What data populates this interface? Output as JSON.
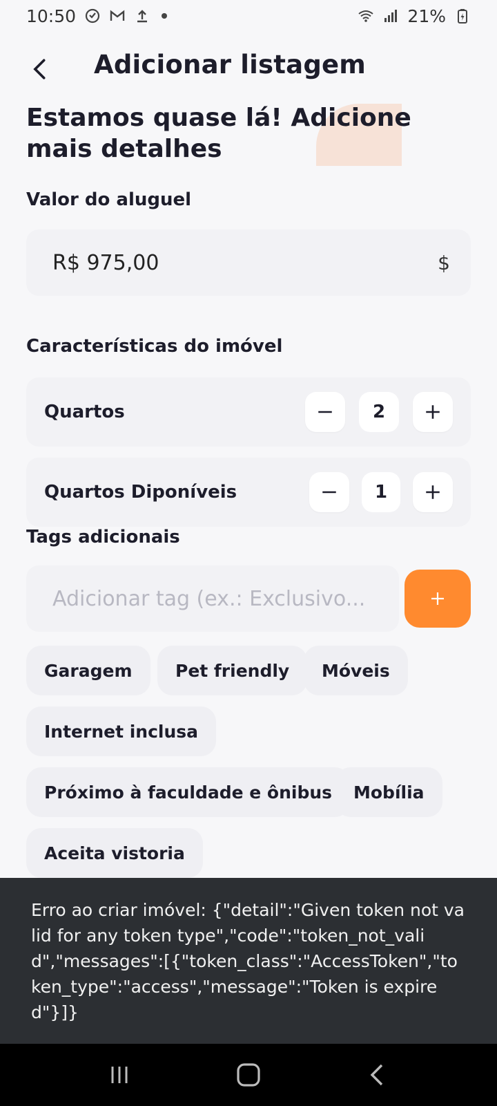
{
  "status_bar": {
    "time": "10:50",
    "battery": "21%",
    "icons_left": [
      "notification-icon",
      "gmail-icon",
      "upload-icon"
    ],
    "icons_right": [
      "wifi-icon",
      "signal-icon",
      "battery-charging-icon"
    ]
  },
  "header": {
    "title": "Adicionar listagem"
  },
  "headline": {
    "line1": "Estamos quase lá! Adicione",
    "line2": "mais detalhes",
    "accent_color": "#f7e2d7"
  },
  "rent": {
    "label": "Valor do aluguel",
    "value": "R$ 975,00",
    "suffix": "$"
  },
  "features": {
    "label": "Características do imóvel",
    "rows": [
      {
        "label": "Quartos",
        "value": "2"
      },
      {
        "label": "Quartos Diponíveis",
        "value": "1"
      }
    ]
  },
  "tags": {
    "label": "Tags adicionais",
    "placeholder": "Adicionar tag (ex.: Exclusivo...",
    "add_button_color": "#ff8a2f",
    "items": [
      "Garagem",
      "Pet friendly",
      "Móveis",
      "Internet inclusa",
      "Próximo à faculdade e ônibus",
      "Mobília",
      "Aceita vistoria"
    ]
  },
  "snackbar": {
    "message": "Erro ao criar imóvel: {\"detail\":\"Given token not valid for any token type\",\"code\":\"token_not_valid\",\"messages\":[{\"token_class\":\"AccessToken\",\"token_type\":\"access\",\"message\":\"Token is expired\"}]}"
  },
  "nav_bar": {
    "buttons": [
      "recent-apps-icon",
      "home-icon",
      "back-icon"
    ]
  }
}
